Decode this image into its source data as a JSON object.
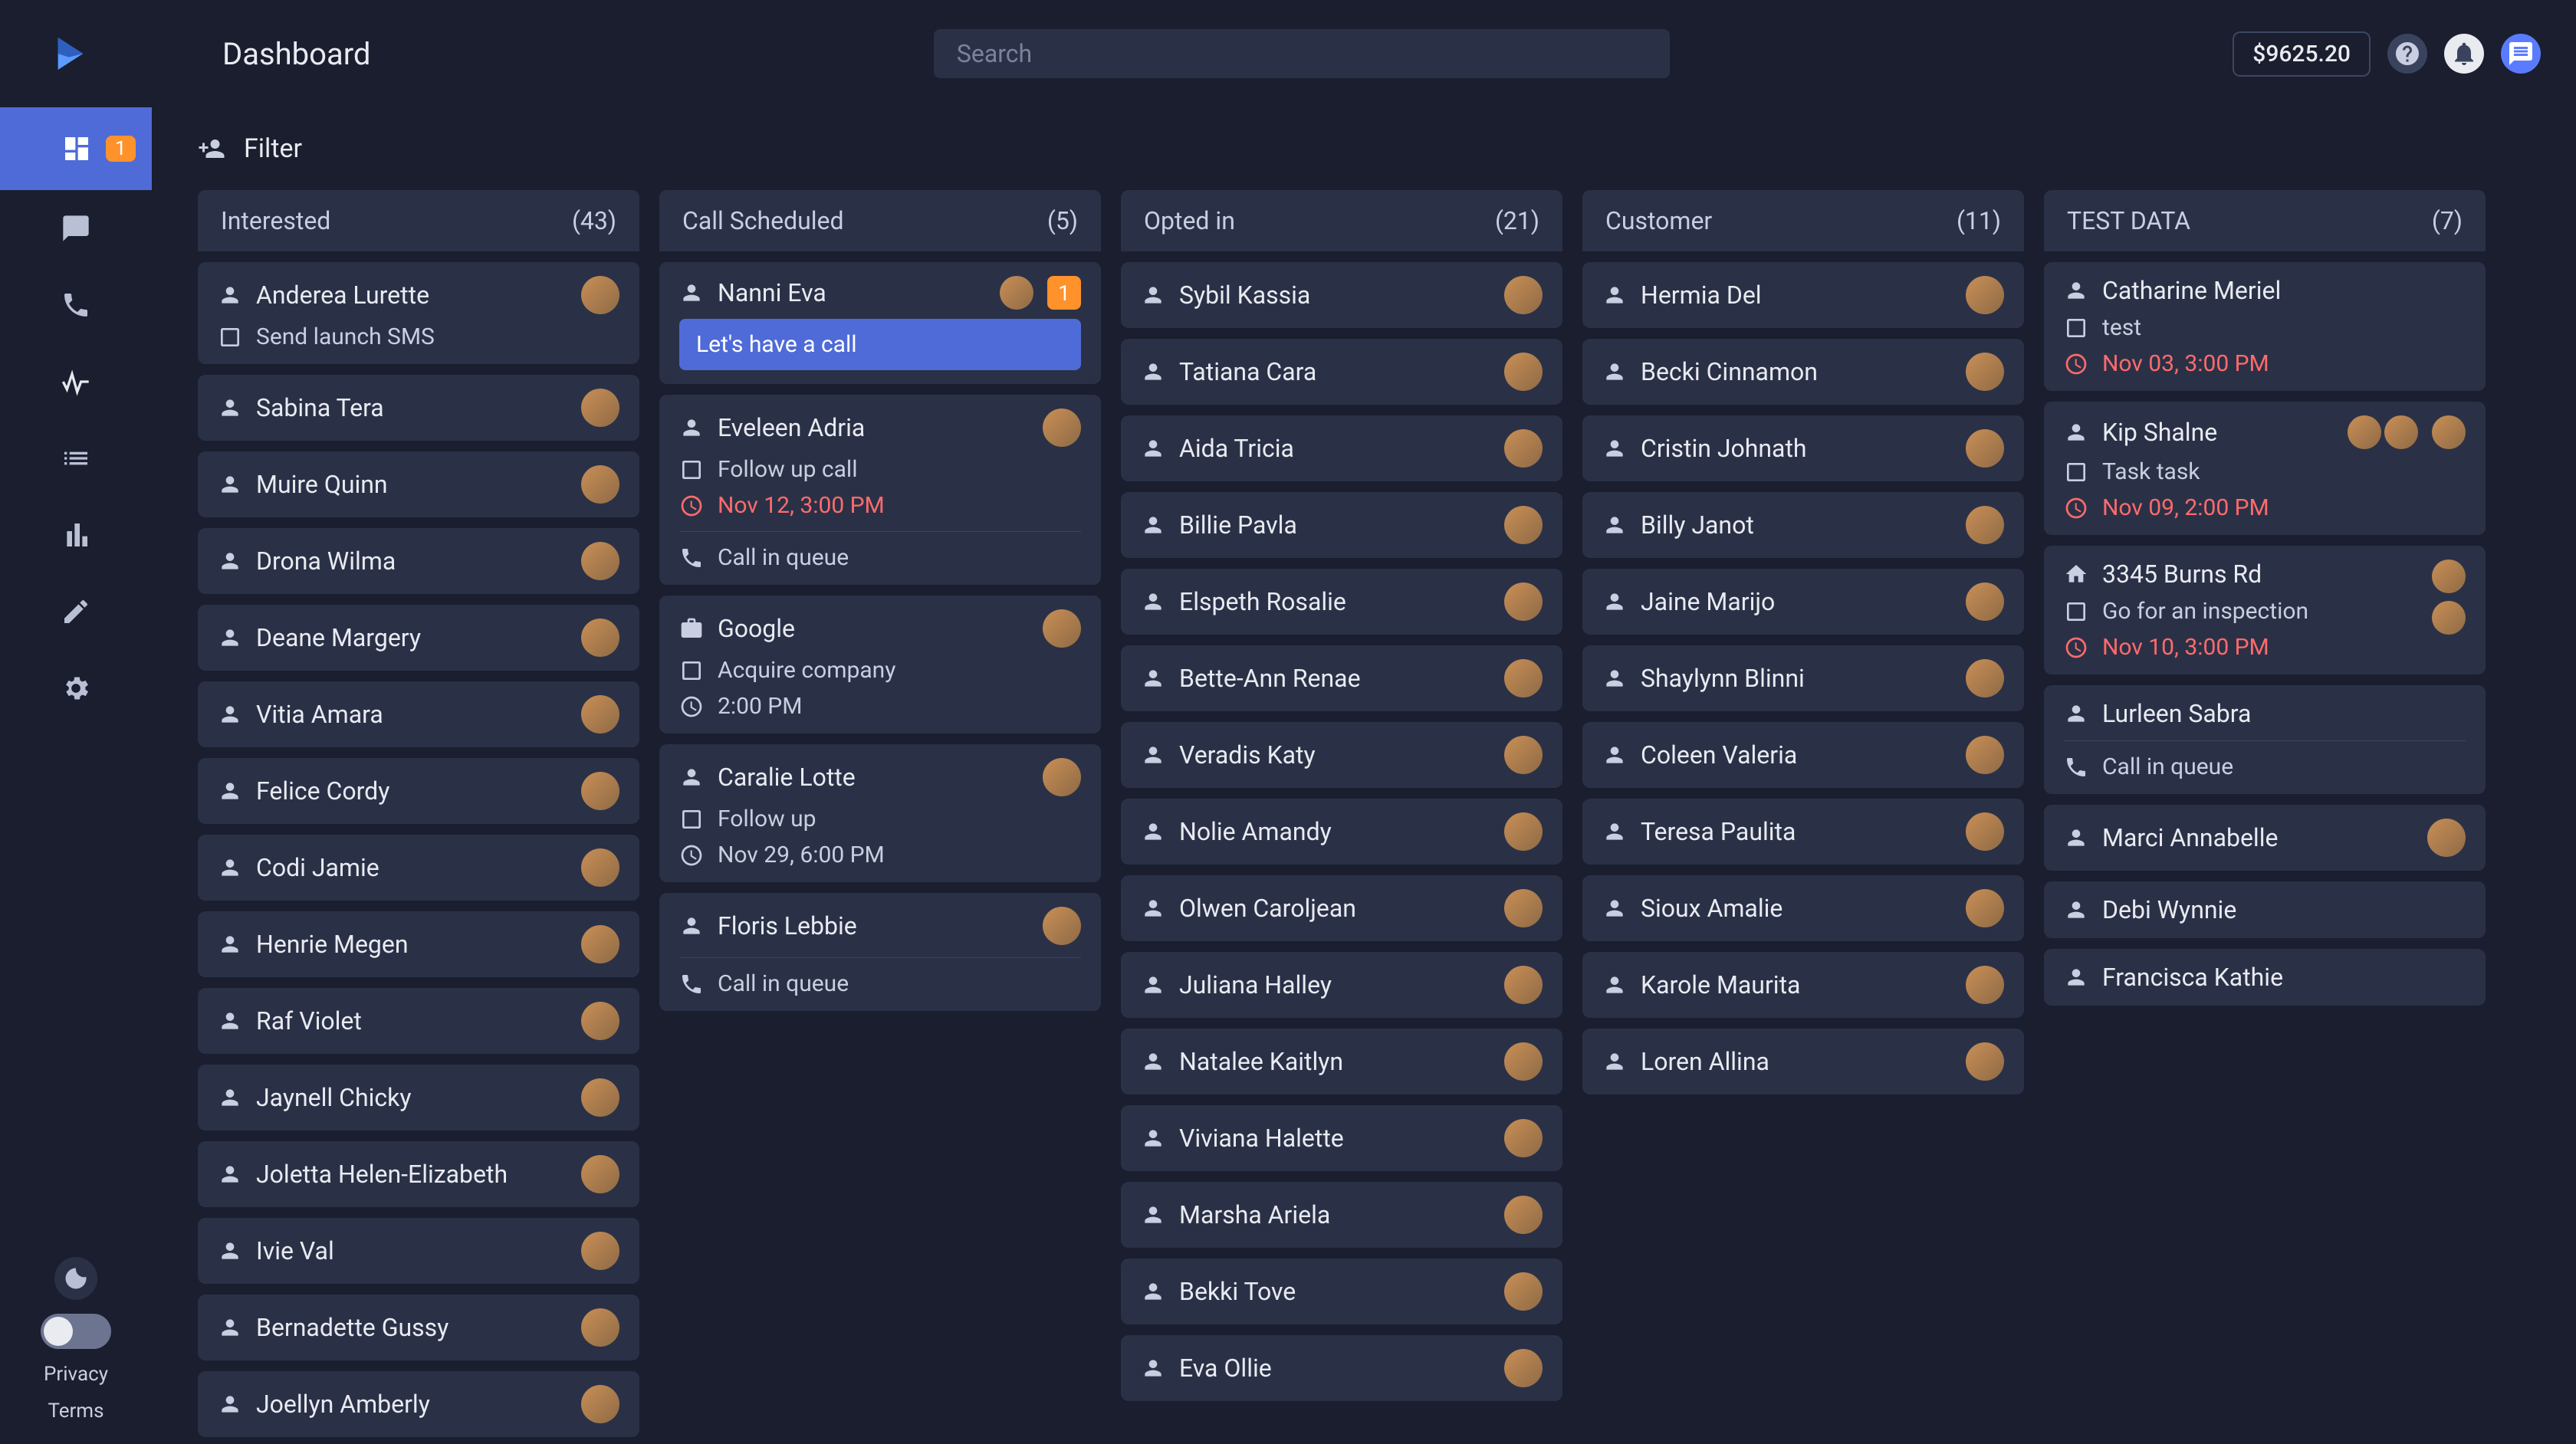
{
  "header": {
    "title": "Dashboard",
    "search_placeholder": "Search",
    "balance": "$9625.20"
  },
  "sidebar": {
    "badge": "1",
    "privacy": "Privacy",
    "terms": "Terms"
  },
  "filter": {
    "label": "Filter"
  },
  "columns": [
    {
      "title": "Interested",
      "count": "(43)",
      "cards": [
        {
          "name": "Anderea Lurette",
          "avatar": 1,
          "subs": [
            {
              "icon": "square",
              "text": "Send launch SMS"
            }
          ]
        },
        {
          "name": "Sabina Tera",
          "avatar": 1
        },
        {
          "name": "Muire Quinn",
          "avatar": 1
        },
        {
          "name": "Drona Wilma",
          "avatar": 1
        },
        {
          "name": "Deane Margery",
          "avatar": 1
        },
        {
          "name": "Vitia Amara",
          "avatar": 1
        },
        {
          "name": "Felice Cordy",
          "avatar": 1
        },
        {
          "name": "Codi Jamie",
          "avatar": 1
        },
        {
          "name": "Henrie Megen",
          "avatar": 1
        },
        {
          "name": "Raf Violet",
          "avatar": 1
        },
        {
          "name": "Jaynell Chicky",
          "avatar": 1
        },
        {
          "name": "Joletta Helen-Elizabeth",
          "avatar": 1
        },
        {
          "name": "Ivie Val",
          "avatar": 1
        },
        {
          "name": "Bernadette Gussy",
          "avatar": 1
        },
        {
          "name": "Joellyn Amberly",
          "avatar": 1
        }
      ]
    },
    {
      "title": "Call Scheduled",
      "count": "(5)",
      "cards": [
        {
          "name": "Nanni Eva",
          "avatar": 1,
          "badge": "1",
          "callout": "Let's have a call"
        },
        {
          "name": "Eveleen Adria",
          "avatar": 1,
          "subs": [
            {
              "icon": "square",
              "text": "Follow up call"
            },
            {
              "icon": "clock",
              "text": "Nov 12, 3:00 PM",
              "red": true
            }
          ],
          "divider": true,
          "after": [
            {
              "icon": "phone",
              "text": "Call in queue"
            }
          ]
        },
        {
          "icon": "briefcase",
          "name": "Google",
          "avatar": 1,
          "subs": [
            {
              "icon": "square",
              "text": "Acquire company"
            },
            {
              "icon": "clock",
              "text": "2:00 PM"
            }
          ]
        },
        {
          "name": "Caralie Lotte",
          "avatar": 1,
          "subs": [
            {
              "icon": "square",
              "text": "Follow up"
            },
            {
              "icon": "clock",
              "text": "Nov 29, 6:00 PM"
            }
          ]
        },
        {
          "name": "Floris Lebbie",
          "avatar": 1,
          "divider": true,
          "after": [
            {
              "icon": "phone",
              "text": "Call in queue"
            }
          ]
        }
      ]
    },
    {
      "title": "Opted in",
      "count": "(21)",
      "cards": [
        {
          "name": "Sybil Kassia",
          "avatar": 1
        },
        {
          "name": "Tatiana Cara",
          "avatar": 1
        },
        {
          "name": "Aida Tricia",
          "avatar": 1
        },
        {
          "name": "Billie Pavla",
          "avatar": 1
        },
        {
          "name": "Elspeth Rosalie",
          "avatar": 1
        },
        {
          "name": "Bette-Ann Renae",
          "avatar": 1
        },
        {
          "name": "Veradis Katy",
          "avatar": 1
        },
        {
          "name": "Nolie Amandy",
          "avatar": 1
        },
        {
          "name": "Olwen Caroljean",
          "avatar": 1
        },
        {
          "name": "Juliana Halley",
          "avatar": 1
        },
        {
          "name": "Natalee Kaitlyn",
          "avatar": 1
        },
        {
          "name": "Viviana Halette",
          "avatar": 1
        },
        {
          "name": "Marsha Ariela",
          "avatar": 1
        },
        {
          "name": "Bekki Tove",
          "avatar": 1
        },
        {
          "name": "Eva Ollie",
          "avatar": 1
        }
      ]
    },
    {
      "title": "Customer",
      "count": "(11)",
      "cards": [
        {
          "name": "Hermia Del",
          "avatar": 1
        },
        {
          "name": "Becki Cinnamon",
          "avatar": 1
        },
        {
          "name": "Cristin Johnath",
          "avatar": 1
        },
        {
          "name": "Billy Janot",
          "avatar": 1
        },
        {
          "name": "Jaine Marijo",
          "avatar": 1
        },
        {
          "name": "Shaylynn Blinni",
          "avatar": 1
        },
        {
          "name": "Coleen Valeria",
          "avatar": 1
        },
        {
          "name": "Teresa Paulita",
          "avatar": 1
        },
        {
          "name": "Sioux Amalie",
          "avatar": 1
        },
        {
          "name": "Karole Maurita",
          "avatar": 1
        },
        {
          "name": "Loren Allina",
          "avatar": 1
        }
      ]
    },
    {
      "title": "TEST DATA",
      "count": "(7)",
      "cards": [
        {
          "name": "Catharine Meriel",
          "subs": [
            {
              "icon": "square",
              "text": "test"
            },
            {
              "icon": "clock",
              "text": "Nov 03, 3:00 PM",
              "red": true
            }
          ]
        },
        {
          "name": "Kip Shalne",
          "multiAvatar": 2,
          "sideAvatar": 1,
          "subs": [
            {
              "icon": "square",
              "text": "Task task"
            },
            {
              "icon": "clock",
              "text": "Nov 09, 2:00 PM",
              "red": true
            }
          ]
        },
        {
          "icon": "home",
          "name": "3345 Burns Rd",
          "sideAvatars": 2,
          "subs": [
            {
              "icon": "square",
              "text": "Go for an inspection"
            },
            {
              "icon": "clock",
              "text": "Nov 10, 3:00 PM",
              "red": true
            }
          ]
        },
        {
          "name": "Lurleen Sabra",
          "divider": true,
          "after": [
            {
              "icon": "phone",
              "text": "Call in queue"
            }
          ]
        },
        {
          "name": "Marci Annabelle",
          "avatar": 1
        },
        {
          "name": "Debi Wynnie"
        },
        {
          "name": "Francisca Kathie"
        }
      ]
    }
  ]
}
